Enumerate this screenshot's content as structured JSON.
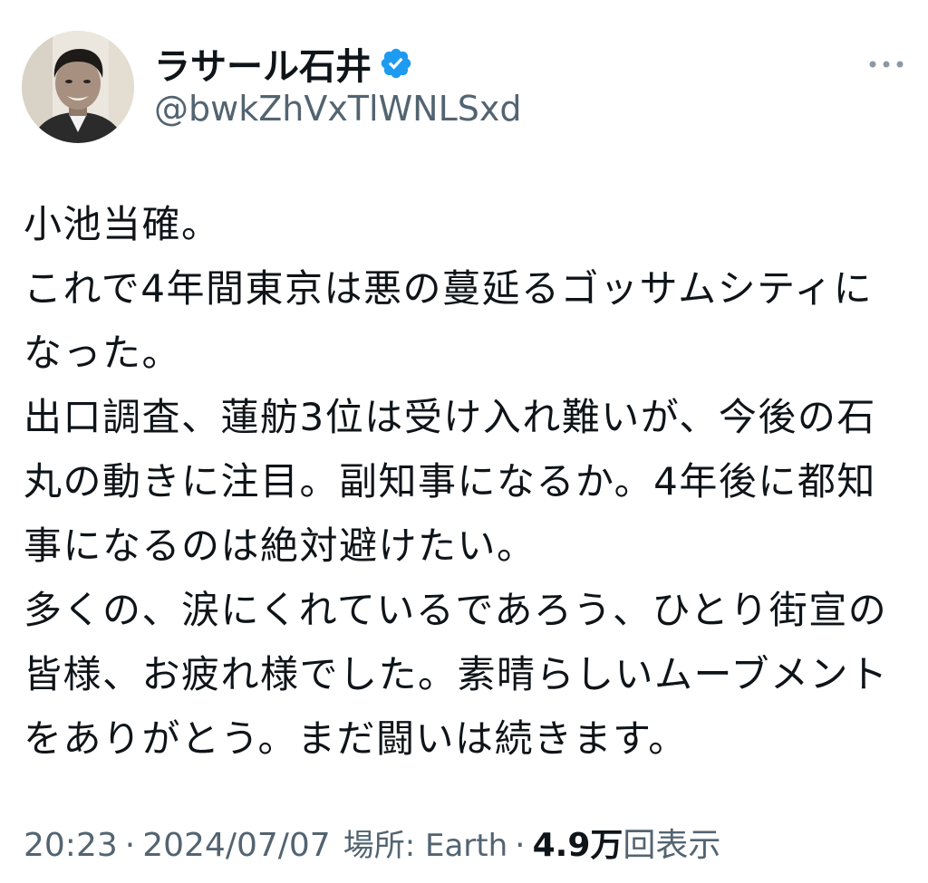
{
  "author": {
    "display_name": "ラサール石井",
    "handle": "@bwkZhVxTlWNLSxd",
    "verified": true,
    "avatar_icon": "profile-photo",
    "verified_icon": "verified-badge-icon",
    "verified_color": "#1d9bf0"
  },
  "more_icon": "more-options-icon",
  "tweet": {
    "lines": [
      "小池当確。",
      "これで4年間東京は悪の蔓延るゴッサムシティに",
      "なった。",
      "出口調査、蓮舫3位は受け入れ難いが、今後の石",
      "丸の動きに注目。副知事になるか。4年後に都知",
      "事になるのは絶対避けたい。",
      "多くの、涙にくれているであろう、ひとり街宣の",
      "皆様、お疲れ様でした。素晴らしいムーブメント",
      "をありがとう。まだ闘いは続きます。"
    ]
  },
  "meta": {
    "time": "20:23",
    "separator": "·",
    "date": "2024/07/07",
    "location": "場所: Earth",
    "views_count": "4.9万",
    "views_label": "回表示"
  }
}
